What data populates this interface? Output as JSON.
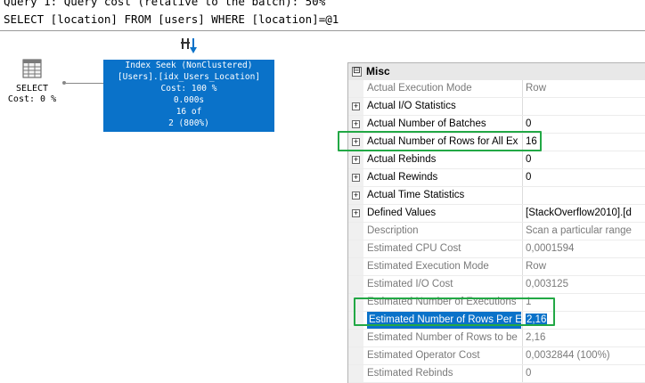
{
  "query": {
    "header_line": "Query 1: Query cost (relative to the batch): 50%",
    "sql": "SELECT [location] FROM [users] WHERE [location]=@1"
  },
  "plan": {
    "select_node": {
      "label": "SELECT",
      "cost": "Cost: 0 %"
    },
    "seek_node": {
      "title": "Index Seek (NonClustered)",
      "object": "[Users].[idx_Users_Location]",
      "cost": "Cost: 100 %",
      "time": "0.000s",
      "rows_actual": "16 of",
      "rows_estimated": "2 (800%)"
    }
  },
  "properties": {
    "category": "Misc",
    "category_expander": "⊟",
    "rows": [
      {
        "name": "Actual Execution Mode",
        "value": "Row",
        "expandable": false,
        "dim": true
      },
      {
        "name": "Actual I/O Statistics",
        "value": "",
        "expandable": true,
        "dim": false
      },
      {
        "name": "Actual Number of Batches",
        "value": "0",
        "expandable": true,
        "dim": false
      },
      {
        "name": "Actual Number of Rows for All Ex",
        "value": "16",
        "expandable": true,
        "dim": false
      },
      {
        "name": "Actual Rebinds",
        "value": "0",
        "expandable": true,
        "dim": false
      },
      {
        "name": "Actual Rewinds",
        "value": "0",
        "expandable": true,
        "dim": false
      },
      {
        "name": "Actual Time Statistics",
        "value": "",
        "expandable": true,
        "dim": false
      },
      {
        "name": "Defined Values",
        "value": "[StackOverflow2010].[d",
        "expandable": true,
        "dim": false
      },
      {
        "name": "Description",
        "value": "Scan a particular range",
        "expandable": false,
        "dim": true
      },
      {
        "name": "Estimated CPU Cost",
        "value": "0,0001594",
        "expandable": false,
        "dim": true
      },
      {
        "name": "Estimated Execution Mode",
        "value": "Row",
        "expandable": false,
        "dim": true
      },
      {
        "name": "Estimated I/O Cost",
        "value": "0,003125",
        "expandable": false,
        "dim": true
      },
      {
        "name": "Estimated Number of Executions",
        "value": "1",
        "expandable": false,
        "dim": true
      },
      {
        "name": "Estimated Number of Rows Per E",
        "value": "2,16",
        "expandable": false,
        "dim": true,
        "selected": true
      },
      {
        "name": "Estimated Number of Rows to be",
        "value": "2,16",
        "expandable": false,
        "dim": true
      },
      {
        "name": "Estimated Operator Cost",
        "value": "0,0032844 (100%)",
        "expandable": false,
        "dim": true
      },
      {
        "name": "Estimated Rebinds",
        "value": "0",
        "expandable": false,
        "dim": true
      }
    ]
  },
  "colors": {
    "seek_fill": "#0a72c9",
    "highlight": "#22a845",
    "selected_row": "#0a72c9"
  },
  "icons": {
    "select_operator": "table-grid-icon",
    "parallelism": "parallel-arrows-icon",
    "expander": "plus-box-icon"
  }
}
